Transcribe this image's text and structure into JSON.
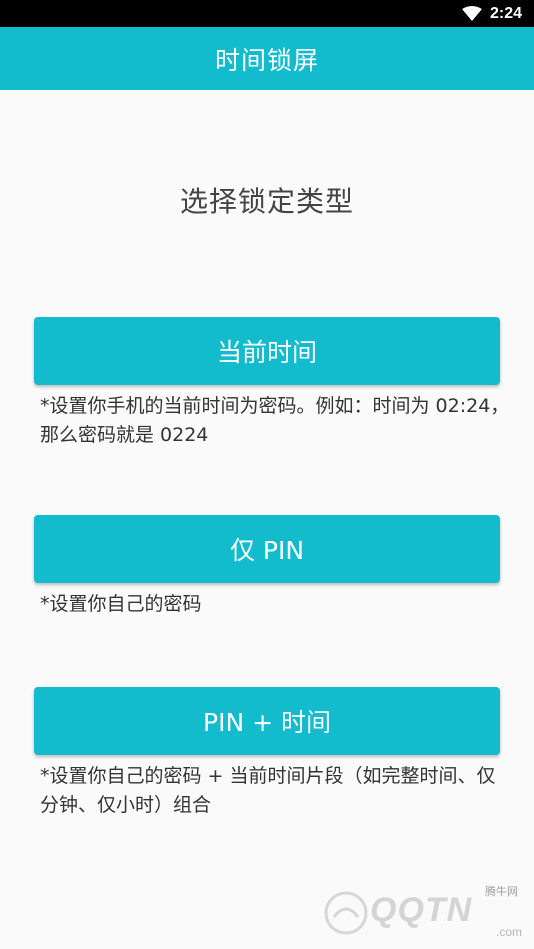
{
  "status_bar": {
    "time": "2:24",
    "wifi_icon": "wifi-icon"
  },
  "app_bar": {
    "title": "时间锁屏"
  },
  "main": {
    "heading": "选择锁定类型",
    "options": [
      {
        "label": "当前时间",
        "description": "*设置你手机的当前时间为密码。例如：时间为 02:24，那么密码就是 0224"
      },
      {
        "label": "仅 PIN",
        "description": "*设置你自己的密码"
      },
      {
        "label": "PIN + 时间",
        "description": "*设置你自己的密码 + 当前时间片段（如完整时间、仅分钟、仅小时）组合"
      }
    ]
  },
  "watermark": {
    "brand": "QQTN",
    "domain": ".com",
    "cn_name": "腾牛网"
  },
  "colors": {
    "accent": "#12bccd",
    "background": "#fafafa",
    "status_bar": "#000000"
  }
}
